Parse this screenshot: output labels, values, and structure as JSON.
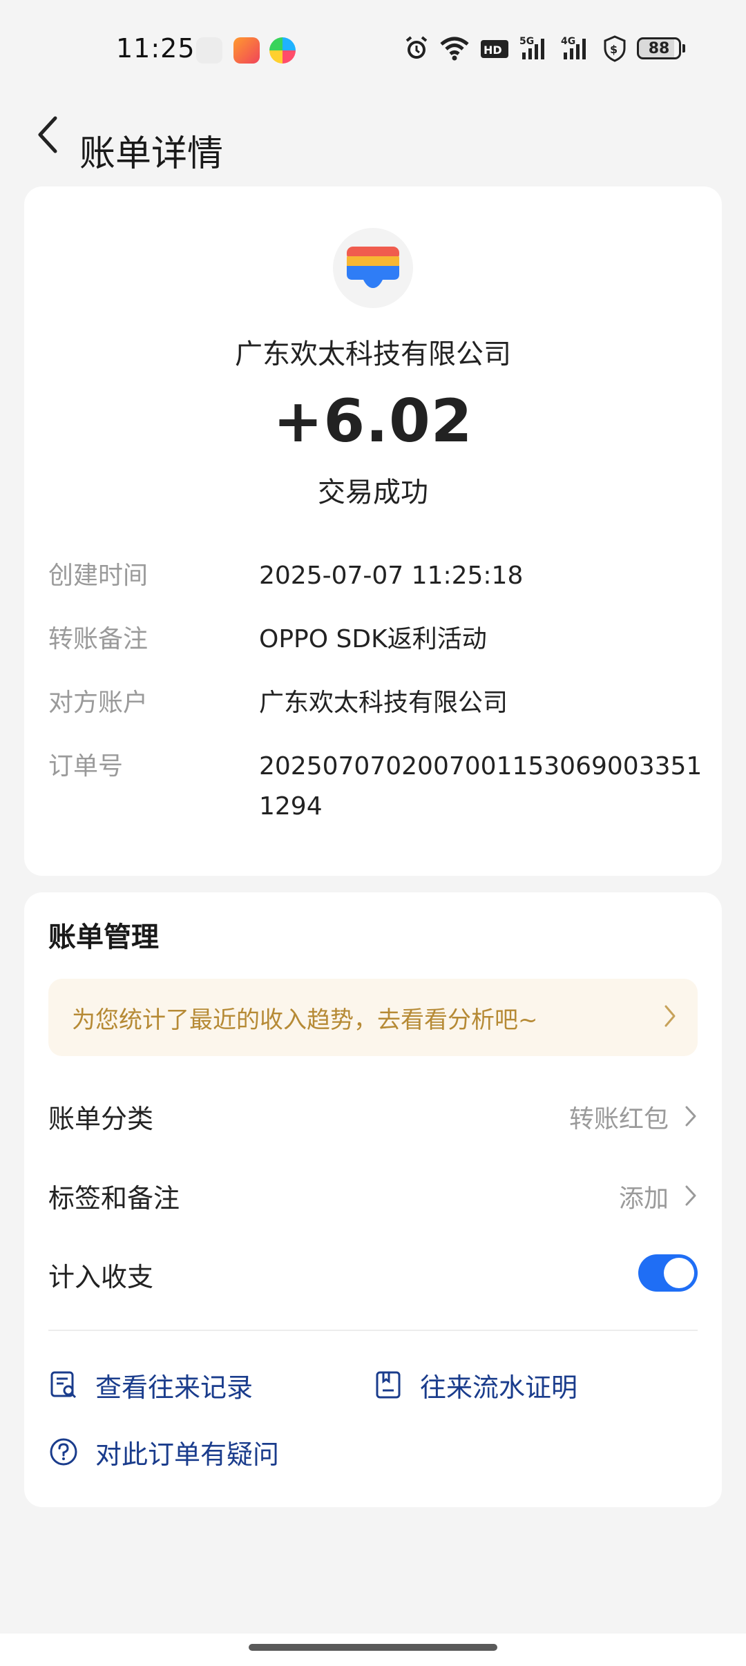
{
  "status_bar": {
    "time": "11:25",
    "battery": "88",
    "icons": [
      "alarm-icon",
      "wifi-icon",
      "hd-icon",
      "5g-signal-icon",
      "4g-signal-icon",
      "shield-dollar-icon",
      "battery-icon"
    ]
  },
  "header": {
    "title": "账单详情",
    "back_icon": "chevron-left-icon"
  },
  "transaction": {
    "logo_icon": "wallet-icon",
    "merchant": "广东欢太科技有限公司",
    "amount": "+6.02",
    "status": "交易成功",
    "details": [
      {
        "label": "创建时间",
        "value": "2025-07-07 11:25:18"
      },
      {
        "label": "转账备注",
        "value": "OPPO SDK返利活动"
      },
      {
        "label": "对方账户",
        "value": "广东欢太科技有限公司"
      },
      {
        "label": "订单号",
        "value": "20250707020070011530690033511294"
      }
    ]
  },
  "manage": {
    "title": "账单管理",
    "promo": "为您统计了最近的收入趋势，去看看分析吧~",
    "category": {
      "label": "账单分类",
      "value": "转账红包"
    },
    "tags": {
      "label": "标签和备注",
      "value": "添加"
    },
    "count_in": {
      "label": "计入收支",
      "enabled": true
    },
    "links": [
      {
        "label": "查看往来记录",
        "icon": "records-search-icon"
      },
      {
        "label": "往来流水证明",
        "icon": "statement-icon"
      },
      {
        "label": "对此订单有疑问",
        "icon": "question-icon"
      }
    ]
  },
  "colors": {
    "accent": "#1f6ef5",
    "link": "#1a3c8c",
    "promo_text": "#b68a35",
    "promo_bg": "#fcf6ec"
  }
}
